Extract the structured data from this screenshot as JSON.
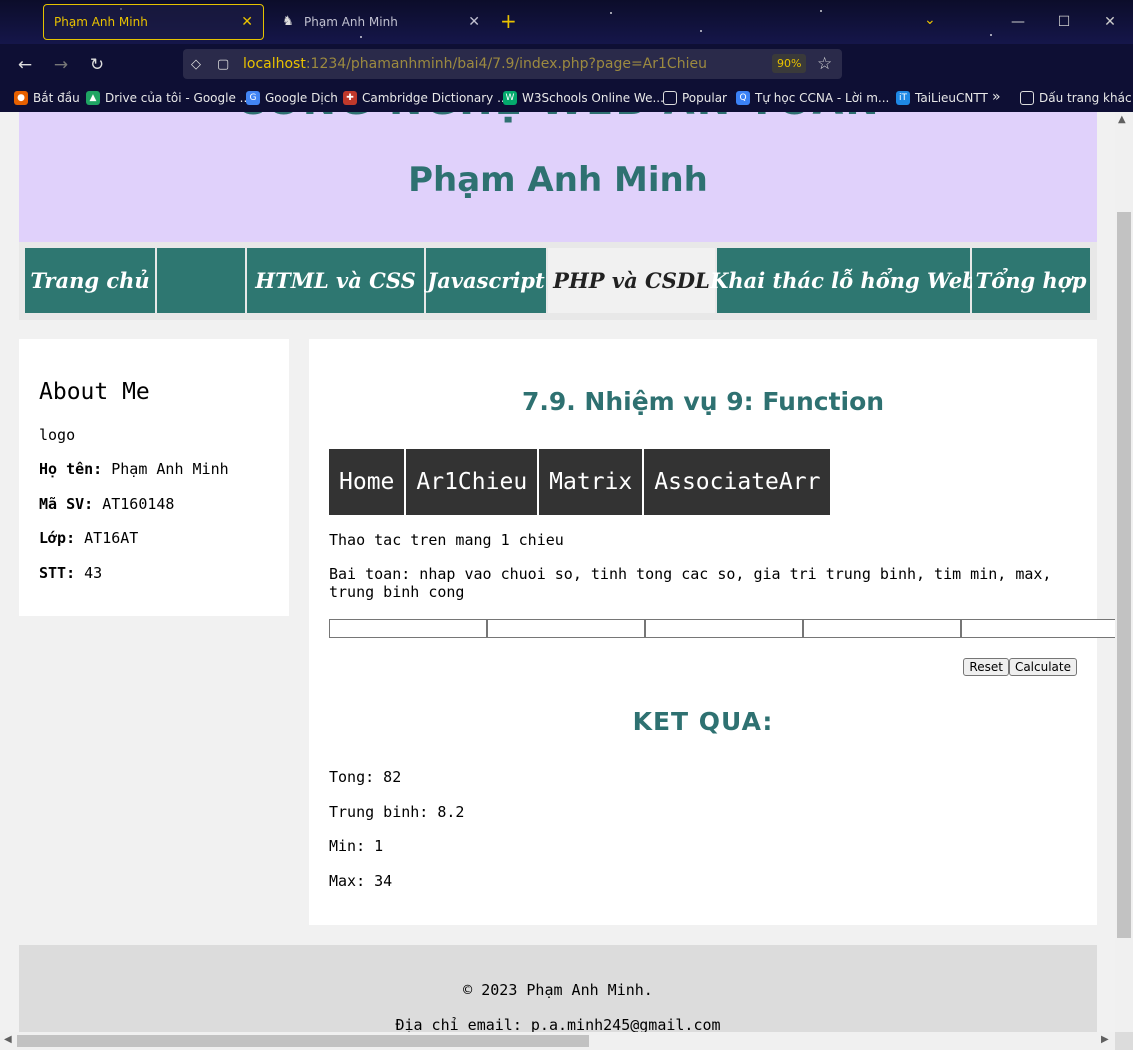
{
  "browser": {
    "tabs": [
      {
        "title": "Phạm Anh Minh",
        "active": true
      },
      {
        "title": "Phạm Anh Minh",
        "active": false
      }
    ],
    "url_host": "localhost",
    "url_path": ":1234/phamanhminh/bai4/7.9/index.php?page=Ar1Chieu",
    "zoom": "90%",
    "bookmarks": [
      {
        "label": "Bắt đầu",
        "icon": "firefox-icon",
        "color": "#e66000"
      },
      {
        "label": "Drive của tôi - Google ...",
        "icon": "google-drive-icon",
        "color": "#1fa463"
      },
      {
        "label": "Google Dịch",
        "icon": "google-translate-icon",
        "color": "#4285f4"
      },
      {
        "label": "Cambridge Dictionary ...",
        "icon": "cambridge-icon",
        "color": "#c0392b"
      },
      {
        "label": "W3Schools Online We...",
        "icon": "w3schools-icon",
        "color": "#04aa6d"
      },
      {
        "label": "Popular",
        "icon": "folder-icon",
        "color": "#e8e8e8"
      },
      {
        "label": "Tự học CCNA - Lời m...",
        "icon": "ccna-icon",
        "color": "#3b82f6"
      },
      {
        "label": "TaiLieuCNTT",
        "icon": "tailieu-icon",
        "color": "#1e88e5"
      },
      {
        "label": "Dấu trang khác",
        "icon": "folder-icon",
        "color": "#e8e8e8"
      }
    ]
  },
  "header": {
    "site_title": "CÔNG NGHỆ WEB AN TOÀN",
    "author": "Phạm Anh Minh"
  },
  "nav": [
    {
      "label": "Trang chủ"
    },
    {
      "label": ""
    },
    {
      "label": "HTML và CSS"
    },
    {
      "label": "Javascript"
    },
    {
      "label": "PHP và CSDL"
    },
    {
      "label": "Khai thác lỗ hổng Web"
    },
    {
      "label": "Tổng hợp"
    }
  ],
  "sidebar": {
    "title": "About Me",
    "logo": "logo",
    "name_label": "Họ tên:",
    "name": "Phạm Anh Minh",
    "id_label": "Mã SV:",
    "id": "AT160148",
    "class_label": "Lớp:",
    "class": "AT16AT",
    "stt_label": "STT:",
    "stt": "43"
  },
  "main": {
    "title": "7.9. Nhiệm vụ 9: Function",
    "subnav": [
      "Home",
      "Ar1Chieu",
      "Matrix",
      "AssociateArr"
    ],
    "intro": "Thao tac tren mang 1 chieu",
    "problem": "Bai toan: nhap vao chuoi so, tinh tong cac so, gia tri trung binh, tim min, max, trung binh cong",
    "reset_label": "Reset",
    "calculate_label": "Calculate",
    "result_title": "KET QUA:",
    "tong": "Tong: 82",
    "trung_binh": "Trung binh: 8.2",
    "min": "Min: 1",
    "max": "Max: 34"
  },
  "footer": {
    "copyright": "© 2023 Phạm Anh Minh.",
    "email": "Địa chỉ email: p.a.minh245@gmail.com"
  },
  "colors": {
    "teal": "#2e7771",
    "header_bg": "#e0d1fb",
    "subnav_bg": "#333333",
    "browser_accent": "#e9c200"
  }
}
